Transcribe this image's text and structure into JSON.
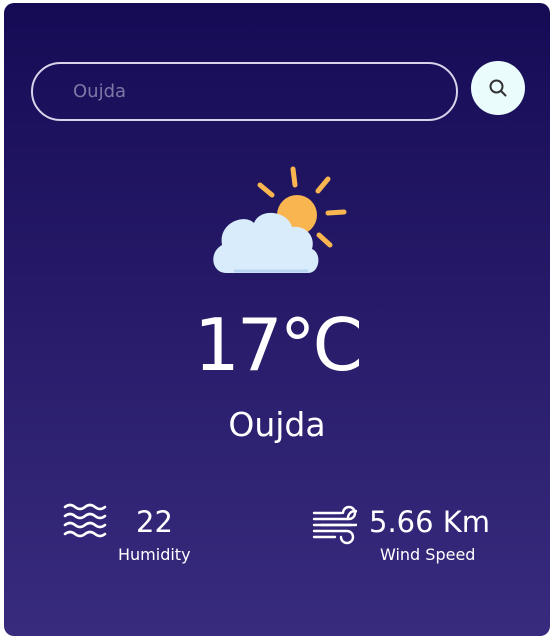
{
  "search": {
    "value": "",
    "placeholder": "Oujda"
  },
  "weather": {
    "icon": "partly-cloudy-icon",
    "temperature": "17°C",
    "city": "Oujda"
  },
  "humidity": {
    "value": "22",
    "label": "Humidity",
    "icon": "water-waves-icon"
  },
  "wind": {
    "value": "5.66 Km",
    "label": "Wind Speed",
    "icon": "wind-icon"
  },
  "colors": {
    "background_top": "#150b55",
    "background_bottom": "#382b7e",
    "search_button_bg": "#eafcfb",
    "sun": "#f8b550",
    "cloud": "#d9ecfb",
    "text": "#ffffff"
  }
}
